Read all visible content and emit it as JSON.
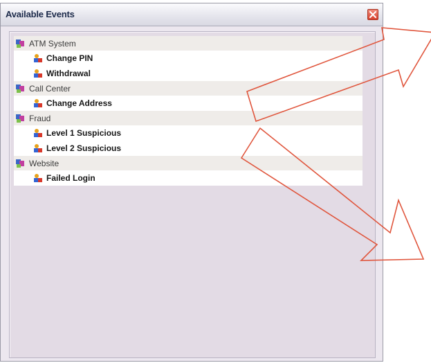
{
  "window": {
    "title": "Available Events",
    "close_icon": "close-icon"
  },
  "events": {
    "groups": [
      {
        "label": "ATM System",
        "icon": "category-icon",
        "items": [
          {
            "label": "Change PIN",
            "icon": "event-icon"
          },
          {
            "label": "Withdrawal",
            "icon": "event-icon"
          }
        ]
      },
      {
        "label": "Call Center",
        "icon": "category-icon",
        "items": [
          {
            "label": "Change Address",
            "icon": "event-icon"
          }
        ]
      },
      {
        "label": "Fraud",
        "icon": "category-icon",
        "items": [
          {
            "label": "Level 1 Suspicious",
            "icon": "event-icon"
          },
          {
            "label": "Level 2 Suspicious",
            "icon": "event-icon"
          }
        ]
      },
      {
        "label": "Website",
        "icon": "category-icon",
        "items": [
          {
            "label": "Failed Login",
            "icon": "event-icon"
          }
        ]
      }
    ]
  },
  "colors": {
    "annotation_arrow": "#e0553c",
    "panel_background": "#e3dbe5",
    "group_row_background": "#efece9",
    "close_button": "#d8412d"
  }
}
